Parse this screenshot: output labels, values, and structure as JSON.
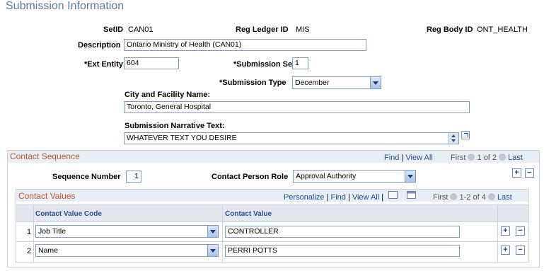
{
  "page": {
    "title": "Submission Information"
  },
  "header": {
    "setid_label": "SetID",
    "setid_value": "CAN01",
    "reg_ledger_label": "Reg Ledger ID",
    "reg_ledger_value": "MIS",
    "reg_body_label": "Reg Body ID",
    "reg_body_value": "ONT_HEALTH",
    "description_label": "Description",
    "description_value": "Ontario Ministry of Health (CAN01)",
    "ext_entity_label": "*Ext Entity",
    "ext_entity_value": "604",
    "submission_seq_label": "*Submission Seq",
    "submission_seq_value": "1",
    "submission_type_label": "*Submission Type",
    "submission_type_value": "December",
    "city_label": "City and Facility Name:",
    "city_value": "Toronto, General Hospital",
    "narrative_label": "Submission Narrative Text:",
    "narrative_value": "WHATEVER TEXT YOU DESIRE"
  },
  "contact_sequence": {
    "title": "Contact Sequence",
    "find": "Find",
    "view_all": "View All",
    "first": "First",
    "count": "1 of 2",
    "last": "Last",
    "seq_label": "Sequence Number",
    "seq_value": "1",
    "role_label": "Contact Person Role",
    "role_value": "Approval Authority"
  },
  "contact_values": {
    "title": "Contact Values",
    "personalize": "Personalize",
    "find": "Find",
    "view_all": "View All",
    "first": "First",
    "count": "1-2 of 4",
    "last": "Last",
    "columns": [
      "Contact Value Code",
      "Contact Value"
    ],
    "rows": [
      {
        "num": "1",
        "code": "Job Title",
        "value": "CONTROLLER"
      },
      {
        "num": "2",
        "code": "Name",
        "value": "PERRI POTTS"
      }
    ]
  },
  "icons": {
    "add": "+",
    "remove": "−"
  }
}
